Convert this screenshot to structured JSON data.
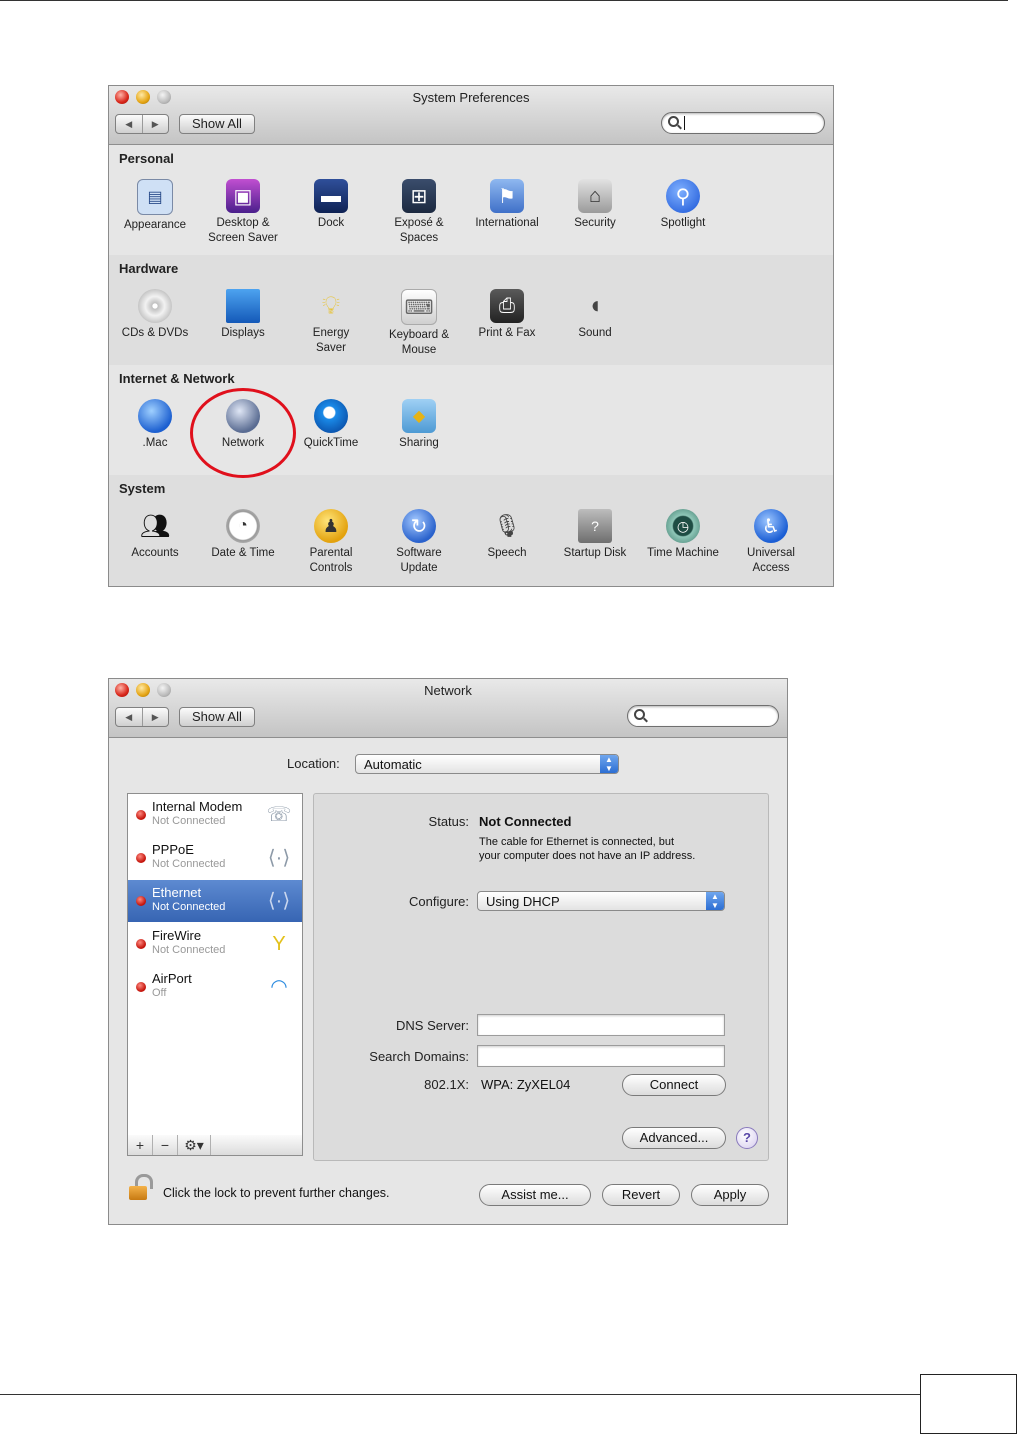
{
  "sysprefs": {
    "title": "System Preferences",
    "show_all": "Show All",
    "sections": [
      {
        "label": "Personal",
        "items": [
          "Appearance",
          "Desktop &\nScreen Saver",
          "Dock",
          "Exposé &\nSpaces",
          "International",
          "Security",
          "Spotlight"
        ]
      },
      {
        "label": "Hardware",
        "items": [
          "CDs & DVDs",
          "Displays",
          "Energy\nSaver",
          "Keyboard &\nMouse",
          "Print & Fax",
          "Sound"
        ]
      },
      {
        "label": "Internet & Network",
        "items": [
          ".Mac",
          "Network",
          "QuickTime",
          "Sharing"
        ]
      },
      {
        "label": "System",
        "items": [
          "Accounts",
          "Date & Time",
          "Parental\nControls",
          "Software\nUpdate",
          "Speech",
          "Startup Disk",
          "Time Machine",
          "Universal\nAccess"
        ]
      }
    ]
  },
  "network": {
    "title": "Network",
    "show_all": "Show All",
    "location_label": "Location:",
    "location_value": "Automatic",
    "services": [
      {
        "name": "Internal Modem",
        "status": "Not Connected"
      },
      {
        "name": "PPPoE",
        "status": "Not Connected"
      },
      {
        "name": "Ethernet",
        "status": "Not Connected"
      },
      {
        "name": "FireWire",
        "status": "Not Connected"
      },
      {
        "name": "AirPort",
        "status": "Off"
      }
    ],
    "list_tools": [
      "+",
      "−",
      "⚙▾"
    ],
    "status_label": "Status:",
    "status_value": "Not Connected",
    "status_desc_1": "The cable for Ethernet is connected, but",
    "status_desc_2": "your computer does not have an IP address.",
    "configure_label": "Configure:",
    "configure_value": "Using DHCP",
    "dns_label": "DNS Server:",
    "search_domains_label": "Search Domains:",
    "dot1x_label": "802.1X:",
    "dot1x_value": "WPA: ZyXEL04",
    "connect_button": "Connect",
    "advanced_button": "Advanced...",
    "help_button": "?",
    "lock_text": "Click the lock to prevent further changes.",
    "assist_button": "Assist me...",
    "revert_button": "Revert",
    "apply_button": "Apply"
  }
}
